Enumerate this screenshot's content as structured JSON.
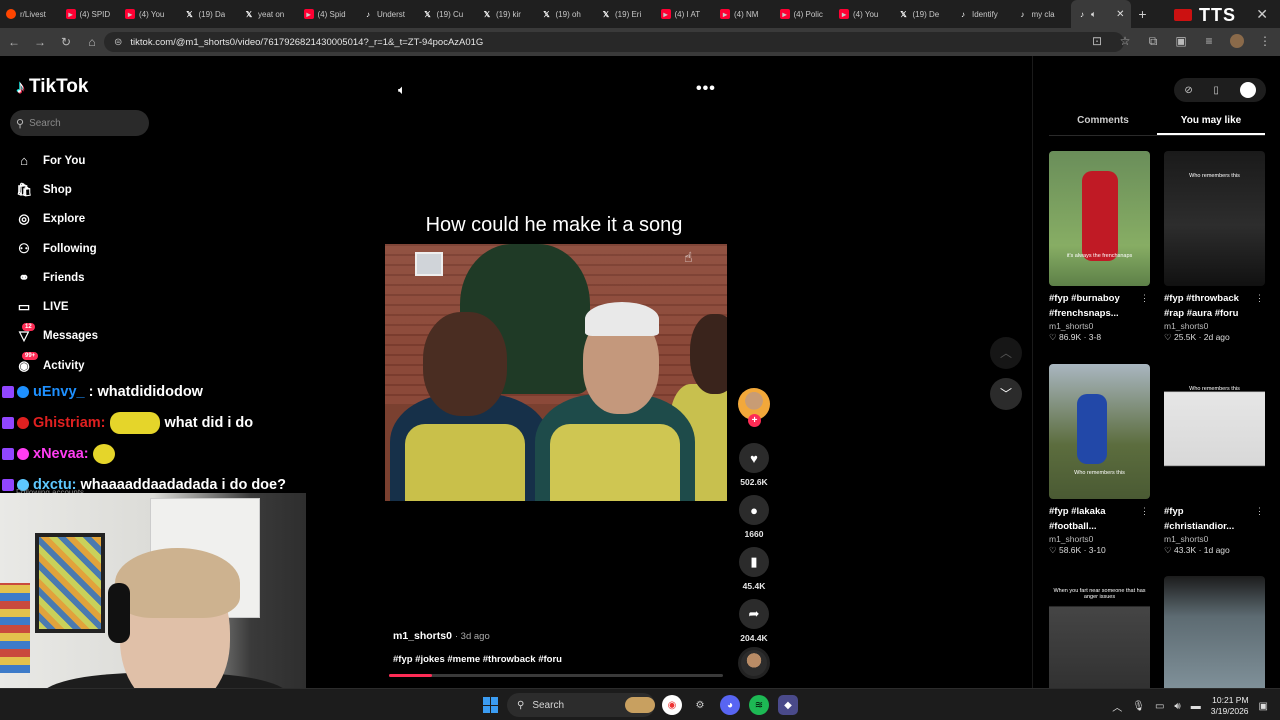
{
  "browser": {
    "tabs": [
      {
        "icon": "reddit-icon",
        "label": "r/Livest"
      },
      {
        "icon": "youtube-icon",
        "label": "(4) SPID"
      },
      {
        "icon": "youtube-icon",
        "label": "(4) You"
      },
      {
        "icon": "x-icon",
        "label": "(19) Da"
      },
      {
        "icon": "x-icon",
        "label": "yeat on"
      },
      {
        "icon": "youtube-icon",
        "label": "(4) Spid"
      },
      {
        "icon": "tiktok-icon",
        "label": "Underst"
      },
      {
        "icon": "x-icon",
        "label": "(19) Cu"
      },
      {
        "icon": "x-icon",
        "label": "(19) kir"
      },
      {
        "icon": "x-icon",
        "label": "(19) oh"
      },
      {
        "icon": "x-icon",
        "label": "(19) Eri"
      },
      {
        "icon": "youtube-icon",
        "label": "(4) I AT"
      },
      {
        "icon": "youtube-icon",
        "label": "(4) NM"
      },
      {
        "icon": "youtube-icon",
        "label": "(4) Polic"
      },
      {
        "icon": "youtube-icon",
        "label": "(4) You"
      },
      {
        "icon": "x-icon",
        "label": "(19) De"
      },
      {
        "icon": "tiktok-icon",
        "label": "Identify"
      },
      {
        "icon": "tiktok-icon",
        "label": "my cla"
      },
      {
        "icon": "tiktok-icon",
        "label": "",
        "active": true
      }
    ],
    "new_tab": "+",
    "overlay_logo": "TTS",
    "url": "tiktok.com/@m1_shorts0/video/7617926821430005014?_r=1&_t=ZT-94pocAzA01G"
  },
  "nav": {
    "logo": "TikTok",
    "search_placeholder": "Search",
    "items": [
      {
        "icon": "home-icon",
        "glyph": "⌂",
        "label": "For You"
      },
      {
        "icon": "shop-icon",
        "glyph": "🛍",
        "label": "Shop"
      },
      {
        "icon": "compass-icon",
        "glyph": "◎",
        "label": "Explore"
      },
      {
        "icon": "following-icon",
        "glyph": "⚇",
        "label": "Following"
      },
      {
        "icon": "friends-icon",
        "glyph": "⚭",
        "label": "Friends"
      },
      {
        "icon": "live-icon",
        "glyph": "▭",
        "label": "LIVE"
      },
      {
        "icon": "messages-icon",
        "glyph": "▽",
        "label": "Messages",
        "badge": "12"
      },
      {
        "icon": "activity-icon",
        "glyph": "◉",
        "label": "Activity",
        "badge": "99+"
      }
    ],
    "following_accounts": "Following accounts"
  },
  "chat": [
    {
      "user": "uEnvy_",
      "user_color": "#1e90ff",
      "message": ": whatdididodow",
      "emote": false
    },
    {
      "user": "Ghistriam:",
      "user_color": "#e02020",
      "message": "what did i do",
      "emote": true
    },
    {
      "user": "xNevaa:",
      "user_color": "#ff3df2",
      "message": "",
      "emote": true
    },
    {
      "user": "dxctu:",
      "user_color": "#5ec8ff",
      "message": "whaaaaddaadadada i do doe?",
      "emote": false
    }
  ],
  "video": {
    "caption_title": "How could he make it a song",
    "author": "m1_shorts0",
    "time_ago": "· 3d ago",
    "hashtags": "#fyp #jokes #meme #throwback #foru",
    "progress": 0.13,
    "likes": "502.6K",
    "comments": "1660",
    "saves": "45.4K",
    "shares": "204.4K",
    "follow_plus": "+"
  },
  "right_panel": {
    "tabs": [
      {
        "label": "Comments",
        "active": false
      },
      {
        "label": "You may like",
        "active": true
      }
    ],
    "cards": [
      {
        "caption": "#fyp #burnaboy #frenchsnaps...",
        "author": "m1_shorts0",
        "likes": "86.9K",
        "date": "3-8",
        "overlay": "it's always the frenchsnaps"
      },
      {
        "caption": "#fyp #throwback #rap #aura #foru",
        "author": "m1_shorts0",
        "likes": "25.5K",
        "date": "2d ago",
        "overlay": "Who remembers this"
      },
      {
        "caption": "#fyp #lakaka #football...",
        "author": "m1_shorts0",
        "likes": "58.6K",
        "date": "3-10",
        "overlay": "Who remembers this"
      },
      {
        "caption": "#fyp #christiandior...",
        "author": "m1_shorts0",
        "likes": "43.3K",
        "date": "1d ago",
        "overlay": "Who remembers this"
      },
      {
        "caption": "",
        "author": "",
        "likes": "",
        "date": "",
        "overlay": "When you fart near someone that has anger issues"
      },
      {
        "caption": "",
        "author": "",
        "likes": "",
        "date": "",
        "overlay": ""
      }
    ]
  },
  "taskbar": {
    "search": "Search",
    "time": "10:21 PM",
    "date": "3/19/2026"
  },
  "colors": {
    "accent": "#fe2c55",
    "cyan": "#25f4ee",
    "background": "#000000"
  }
}
